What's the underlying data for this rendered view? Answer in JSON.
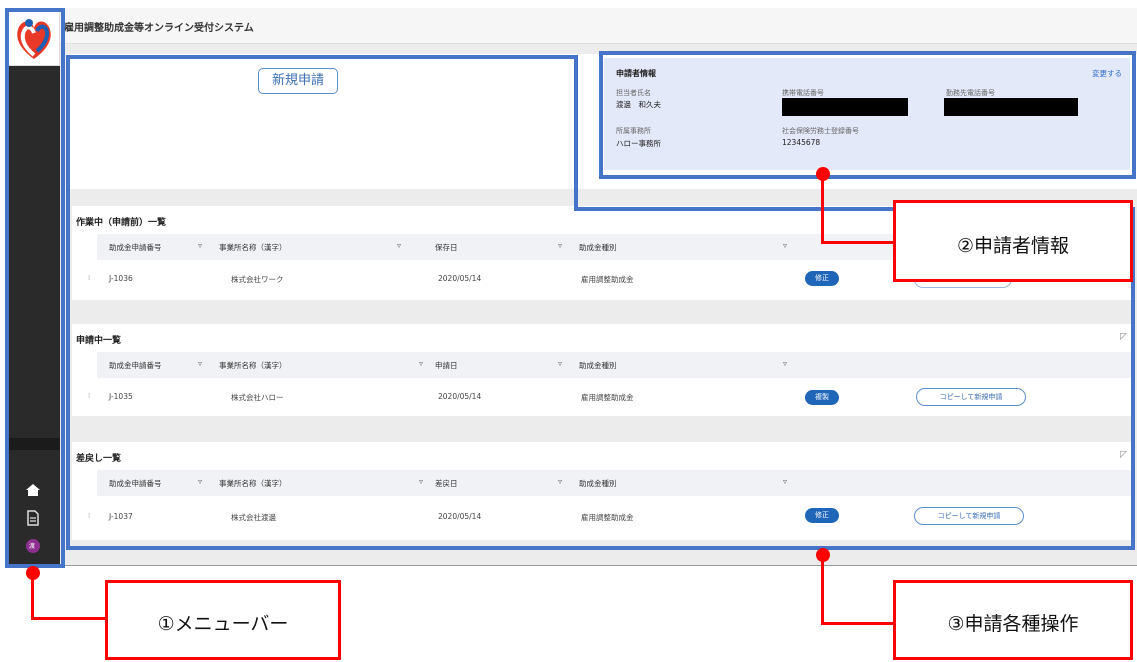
{
  "app": {
    "title": "雇用調整助成金等オンライン受付システム"
  },
  "sidebar": {
    "icons": [
      "home-icon",
      "document-icon",
      "user-avatar-icon"
    ],
    "avatar_text": "渡"
  },
  "top": {
    "new_application_label": "新規申請"
  },
  "applicant_info": {
    "title": "申請者情報",
    "change_link": "変更する",
    "name_label": "担当者氏名",
    "name_value": "渡邊　和久夫",
    "mobile_label": "携帯電話番号",
    "other_phone_label": "勤務先電話番号",
    "office_label": "所属事務所",
    "office_value": "ハロー事務所",
    "registration_label": "社会保険労務士登録番号",
    "registration_value": "12345678"
  },
  "sections": {
    "in_progress": {
      "title": "作業中（申請前）一覧",
      "headers": [
        "助成金申請番号",
        "事業所名称（漢字）",
        "保存日",
        "助成金種別"
      ],
      "rows": [
        {
          "id": "J-1036",
          "company": "株式会社ワーク",
          "date": "2020/05/14",
          "type": "雇用調整助成金",
          "action": "修正"
        }
      ]
    },
    "applying": {
      "title": "申請中一覧",
      "headers": [
        "助成金申請番号",
        "事業所名称（漢字）",
        "申請日",
        "助成金種別"
      ],
      "rows": [
        {
          "id": "J-1035",
          "company": "株式会社ハロー",
          "date": "2020/05/14",
          "type": "雇用調整助成金",
          "action": "複製",
          "copy": "コピーして新規申請"
        }
      ]
    },
    "returned": {
      "title": "差戻し一覧",
      "headers": [
        "助成金申請番号",
        "事業所名称（漢字）",
        "差戻日",
        "助成金種別"
      ],
      "rows": [
        {
          "id": "J-1037",
          "company": "株式会社渡邊",
          "date": "2020/05/14",
          "type": "雇用調整助成金",
          "action": "修正",
          "copy": "コピーして新規申請"
        }
      ]
    }
  },
  "callouts": {
    "menu_bar": "①メニューバー",
    "applicant_info": "②申請者情報",
    "operations": "③申請各種操作"
  },
  "colors": {
    "highlight_blue": "#4674c8",
    "callout_red": "#ff0000",
    "sidebar": "#2a2a2a",
    "info_card": "#e3e9f8"
  }
}
